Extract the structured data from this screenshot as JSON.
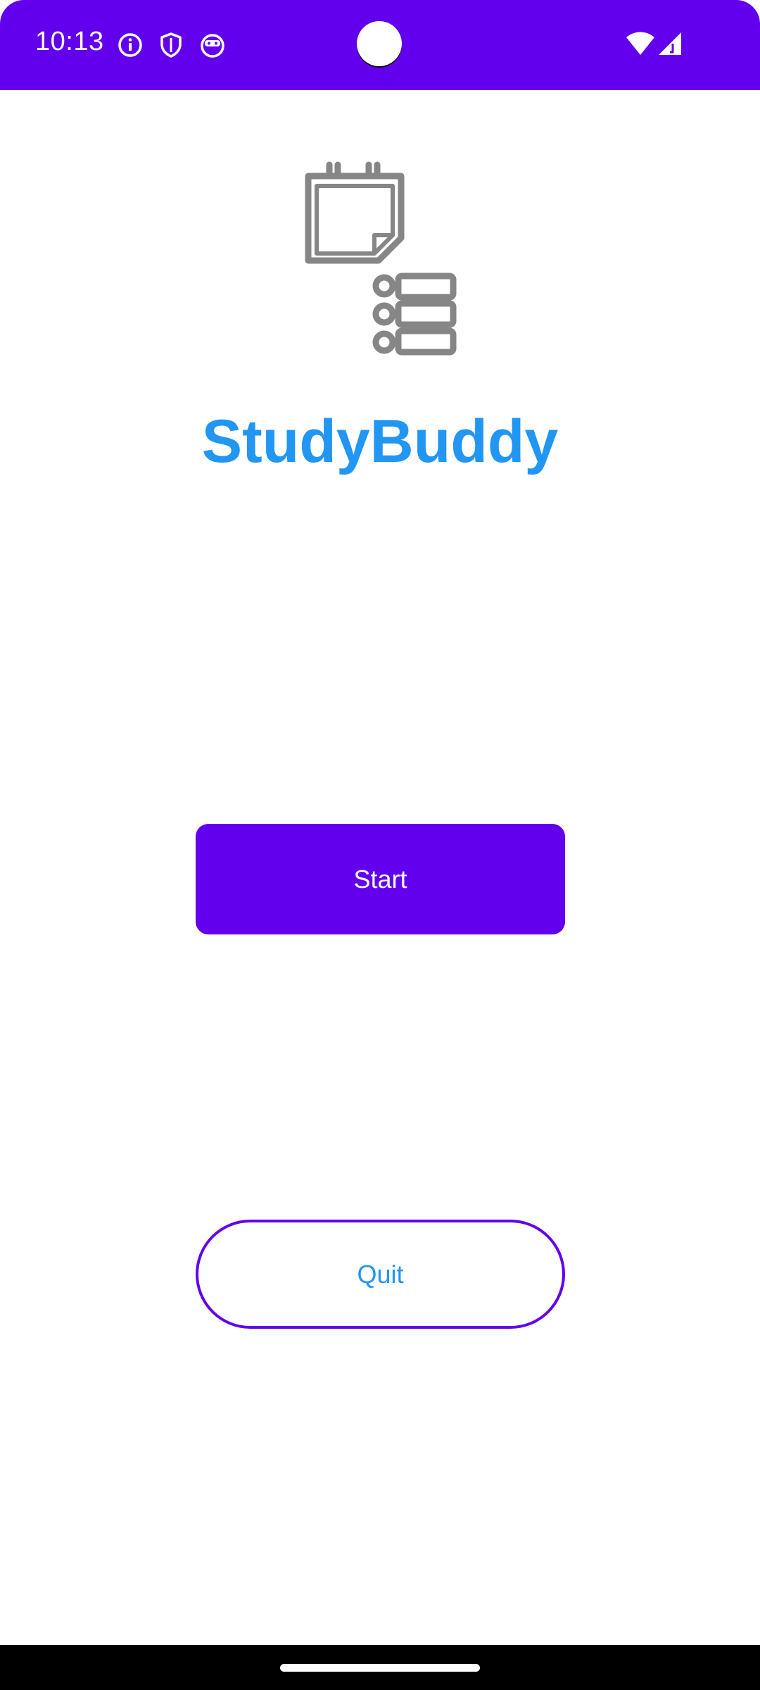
{
  "status_bar": {
    "time": "10:13",
    "color": "#6200EE",
    "left_icons": [
      "info-icon",
      "shield-icon",
      "android-face-icon"
    ],
    "right_icons": [
      "wifi-icon",
      "cellular-signal-icon"
    ]
  },
  "app": {
    "logo_icon": "calendar-list-icon",
    "title": "StudyBuddy",
    "title_color": "#2196F3"
  },
  "buttons": {
    "start_label": "Start",
    "quit_label": "Quit",
    "accent": "#6200EE"
  }
}
